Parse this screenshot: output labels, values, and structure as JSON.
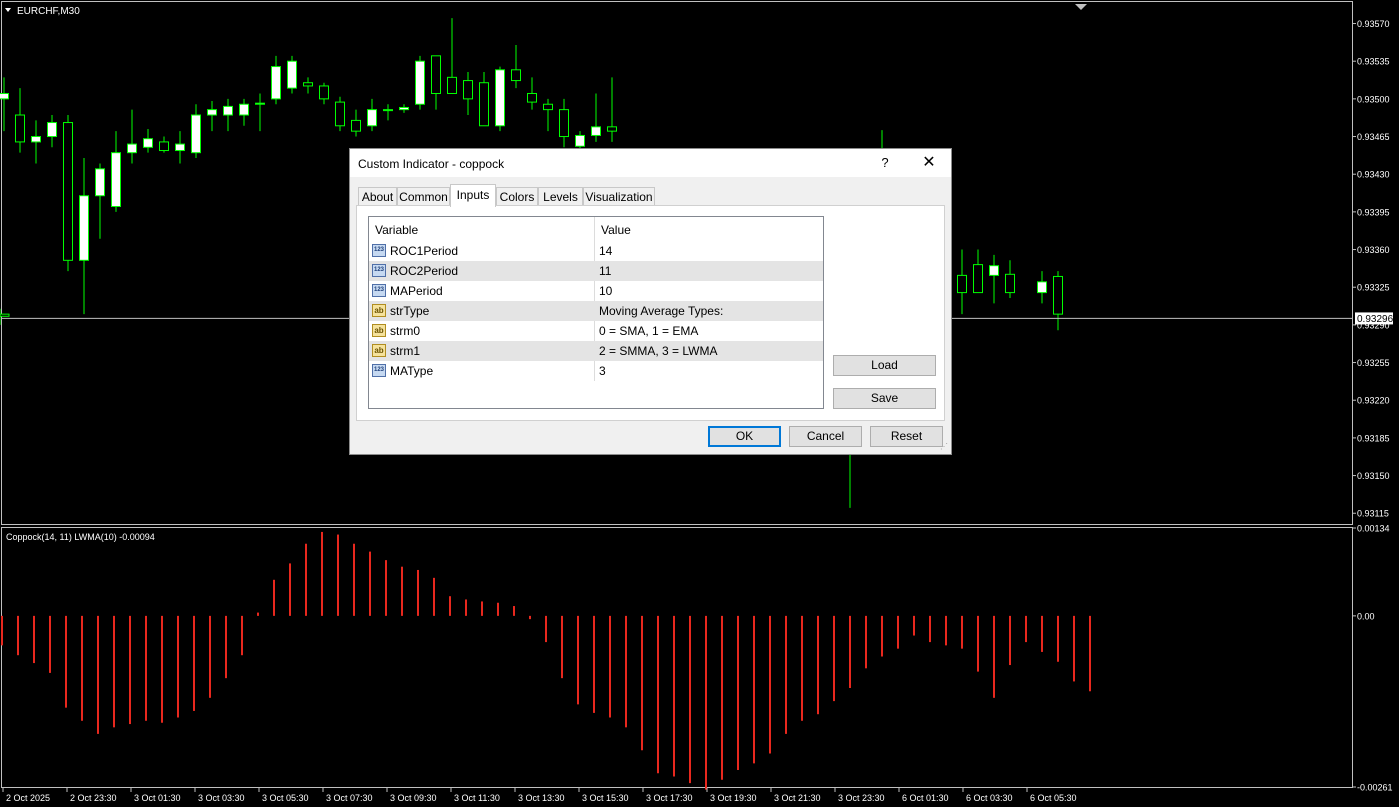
{
  "window": {
    "symbol_label": "EURCHF,M30"
  },
  "price_axis": {
    "ticks": [
      "0.93570",
      "0.93535",
      "0.93500",
      "0.93465",
      "0.93430",
      "0.93395",
      "0.93360",
      "0.93325",
      "0.93290",
      "0.93255",
      "0.93220",
      "0.93185",
      "0.93150",
      "0.93115"
    ],
    "current_price": "0.93296"
  },
  "indicator": {
    "label": "Coppock(14, 11) LWMA(10) -0.00094",
    "axis_ticks": [
      "0.00134",
      "0.00",
      "-0.00261"
    ]
  },
  "time_axis": {
    "ticks": [
      "2 Oct 2025",
      "2 Oct 23:30",
      "3 Oct 01:30",
      "3 Oct 03:30",
      "3 Oct 05:30",
      "3 Oct 07:30",
      "3 Oct 09:30",
      "3 Oct 11:30",
      "3 Oct 13:30",
      "3 Oct 15:30",
      "3 Oct 17:30",
      "3 Oct 19:30",
      "3 Oct 21:30",
      "3 Oct 23:30",
      "6 Oct 01:30",
      "6 Oct 03:30",
      "6 Oct 05:30"
    ]
  },
  "colors": {
    "bull": "#ffffff",
    "bear": "#000000",
    "wick": "#00ff00",
    "histogram": "#e8281e",
    "current_line": "#c0c0c0",
    "accent": "#0078d7"
  },
  "chart_data": [
    {
      "type": "candlestick",
      "title": "EURCHF,M30",
      "ylim": [
        0.93105,
        0.9359
      ],
      "candles": [
        {
          "o": 0.935,
          "h": 0.9352,
          "l": 0.9347,
          "c": 0.93505
        },
        {
          "o": 0.93485,
          "h": 0.9351,
          "l": 0.9345,
          "c": 0.9346
        },
        {
          "o": 0.9346,
          "h": 0.9348,
          "l": 0.9344,
          "c": 0.93465
        },
        {
          "o": 0.93465,
          "h": 0.93485,
          "l": 0.93455,
          "c": 0.93478
        },
        {
          "o": 0.93478,
          "h": 0.93485,
          "l": 0.9334,
          "c": 0.9335
        },
        {
          "o": 0.9335,
          "h": 0.93445,
          "l": 0.933,
          "c": 0.9341
        },
        {
          "o": 0.9341,
          "h": 0.9344,
          "l": 0.9337,
          "c": 0.93435
        },
        {
          "o": 0.934,
          "h": 0.9347,
          "l": 0.93395,
          "c": 0.9345
        },
        {
          "o": 0.9345,
          "h": 0.9349,
          "l": 0.9344,
          "c": 0.93458
        },
        {
          "o": 0.93455,
          "h": 0.93472,
          "l": 0.9345,
          "c": 0.93463
        },
        {
          "o": 0.9346,
          "h": 0.93465,
          "l": 0.9345,
          "c": 0.93452
        },
        {
          "o": 0.93452,
          "h": 0.9347,
          "l": 0.9344,
          "c": 0.93458
        },
        {
          "o": 0.9345,
          "h": 0.93495,
          "l": 0.93445,
          "c": 0.93485
        },
        {
          "o": 0.93485,
          "h": 0.93498,
          "l": 0.9347,
          "c": 0.9349
        },
        {
          "o": 0.93485,
          "h": 0.935,
          "l": 0.9347,
          "c": 0.93493
        },
        {
          "o": 0.93485,
          "h": 0.935,
          "l": 0.93475,
          "c": 0.93495
        },
        {
          "o": 0.93495,
          "h": 0.93505,
          "l": 0.9347,
          "c": 0.93496
        },
        {
          "o": 0.935,
          "h": 0.9354,
          "l": 0.93495,
          "c": 0.9353
        },
        {
          "o": 0.9351,
          "h": 0.9354,
          "l": 0.93505,
          "c": 0.93535
        },
        {
          "o": 0.93515,
          "h": 0.9352,
          "l": 0.93505,
          "c": 0.93512
        },
        {
          "o": 0.93512,
          "h": 0.93515,
          "l": 0.93495,
          "c": 0.935
        },
        {
          "o": 0.93497,
          "h": 0.93502,
          "l": 0.9347,
          "c": 0.93475
        },
        {
          "o": 0.9348,
          "h": 0.9349,
          "l": 0.93465,
          "c": 0.9347
        },
        {
          "o": 0.93475,
          "h": 0.935,
          "l": 0.9347,
          "c": 0.9349
        },
        {
          "o": 0.9349,
          "h": 0.93495,
          "l": 0.9348,
          "c": 0.9349
        },
        {
          "o": 0.9349,
          "h": 0.93495,
          "l": 0.93487,
          "c": 0.93492
        },
        {
          "o": 0.93495,
          "h": 0.9354,
          "l": 0.9349,
          "c": 0.93535
        },
        {
          "o": 0.9354,
          "h": 0.9354,
          "l": 0.9349,
          "c": 0.93505
        },
        {
          "o": 0.9352,
          "h": 0.93575,
          "l": 0.93505,
          "c": 0.93505
        },
        {
          "o": 0.93517,
          "h": 0.93525,
          "l": 0.93485,
          "c": 0.935
        },
        {
          "o": 0.93515,
          "h": 0.93525,
          "l": 0.93475,
          "c": 0.93475
        },
        {
          "o": 0.93475,
          "h": 0.9353,
          "l": 0.9347,
          "c": 0.93527
        },
        {
          "o": 0.93527,
          "h": 0.9355,
          "l": 0.9351,
          "c": 0.93517
        },
        {
          "o": 0.93505,
          "h": 0.9352,
          "l": 0.9349,
          "c": 0.93497
        },
        {
          "o": 0.93495,
          "h": 0.935,
          "l": 0.9347,
          "c": 0.9349
        },
        {
          "o": 0.9349,
          "h": 0.935,
          "l": 0.93455,
          "c": 0.93465
        },
        {
          "o": 0.93456,
          "h": 0.9347,
          "l": 0.9345,
          "c": 0.93466
        },
        {
          "o": 0.93466,
          "h": 0.93505,
          "l": 0.9346,
          "c": 0.93474
        },
        {
          "o": 0.93474,
          "h": 0.9352,
          "l": 0.9346,
          "c": 0.9347
        },
        {
          "o": 0.9323,
          "h": 0.9324,
          "l": 0.9312,
          "c": 0.932
        },
        {
          "o": 0.93442,
          "h": 0.93471,
          "l": 0.93425,
          "c": 0.9345
        },
        {
          "o": 0.93336,
          "h": 0.9336,
          "l": 0.933,
          "c": 0.9332
        },
        {
          "o": 0.93346,
          "h": 0.9336,
          "l": 0.9333,
          "c": 0.9332
        },
        {
          "o": 0.93336,
          "h": 0.93355,
          "l": 0.9331,
          "c": 0.93345
        },
        {
          "o": 0.93337,
          "h": 0.9335,
          "l": 0.93315,
          "c": 0.9332
        },
        {
          "o": 0.9332,
          "h": 0.9334,
          "l": 0.9331,
          "c": 0.9333
        },
        {
          "o": 0.93335,
          "h": 0.9334,
          "l": 0.93285,
          "c": 0.933
        },
        {
          "o": 0.933,
          "h": 0.93305,
          "l": 0.9329,
          "c": 0.93298
        }
      ]
    },
    {
      "type": "bar",
      "title": "Coppock(14, 11) LWMA(10) -0.00094",
      "ylim": [
        -0.00261,
        0.00134
      ],
      "values": [
        -0.00045,
        -0.0006,
        -0.00072,
        -0.00087,
        -0.0014,
        -0.0016,
        -0.0018,
        -0.0017,
        -0.00165,
        -0.0016,
        -0.00163,
        -0.00155,
        -0.00145,
        -0.00125,
        -0.00095,
        -0.0006,
        5e-05,
        0.00055,
        0.0008,
        0.0011,
        0.00128,
        0.00124,
        0.0011,
        0.00098,
        0.00085,
        0.00075,
        0.0007,
        0.00058,
        0.0003,
        0.00025,
        0.00022,
        0.0002,
        0.00015,
        -5e-05,
        -0.0004,
        -0.00095,
        -0.00135,
        -0.00148,
        -0.00155,
        -0.0017,
        -0.00205,
        -0.0024,
        -0.00245,
        -0.00255,
        -0.00265,
        -0.0025,
        -0.00235,
        -0.00225,
        -0.0021,
        -0.0018,
        -0.0016,
        -0.0015,
        -0.0013,
        -0.0011,
        -0.0008,
        -0.00062,
        -0.0005,
        -0.0003,
        -0.0004,
        -0.00045,
        -0.0005,
        -0.00085,
        -0.00125,
        -0.00075,
        -0.0004,
        -0.00055,
        -0.0007,
        -0.001,
        -0.00115
      ]
    }
  ],
  "dialog": {
    "title": "Custom Indicator - coppock",
    "help": "?",
    "close": "✕",
    "tabs": [
      "About",
      "Common",
      "Inputs",
      "Colors",
      "Levels",
      "Visualization"
    ],
    "active_tab": "Inputs",
    "columns": [
      "Variable",
      "Value"
    ],
    "rows": [
      {
        "type": "num",
        "icon": "123",
        "name": "ROC1Period",
        "value": "14"
      },
      {
        "type": "num",
        "icon": "123",
        "name": "ROC2Period",
        "value": "11"
      },
      {
        "type": "num",
        "icon": "123",
        "name": "MAPeriod",
        "value": "10"
      },
      {
        "type": "str",
        "icon": "ab",
        "name": "strType",
        "value": "Moving Average Types:"
      },
      {
        "type": "str",
        "icon": "ab",
        "name": "strm0",
        "value": "0 = SMA,  1 = EMA"
      },
      {
        "type": "str",
        "icon": "ab",
        "name": "strm1",
        "value": "2 = SMMA, 3 = LWMA"
      },
      {
        "type": "num",
        "icon": "123",
        "name": "MAType",
        "value": "3"
      }
    ],
    "buttons": {
      "load": "Load",
      "save": "Save",
      "ok": "OK",
      "cancel": "Cancel",
      "reset": "Reset"
    }
  }
}
